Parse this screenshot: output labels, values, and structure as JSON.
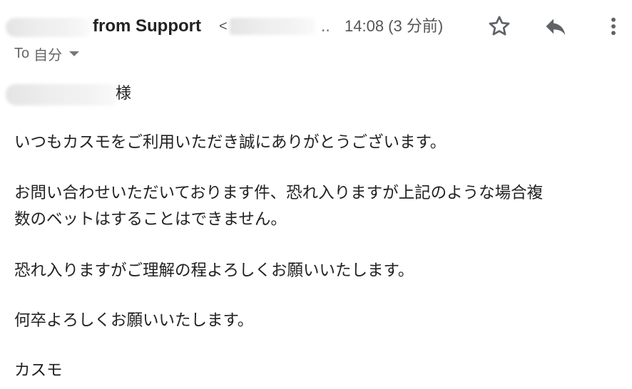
{
  "header": {
    "sender_name": "from Support",
    "sender_bracket": "<",
    "email_ellipsis": "..",
    "time": "14:08 (3 分前)",
    "icons": {
      "star": "star-icon",
      "reply": "reply-icon",
      "more": "more-vert-icon"
    }
  },
  "recipient": {
    "label": "To",
    "value": "自分"
  },
  "body": {
    "salutation_suffix": "様",
    "paragraphs": [
      "いつもカスモをご利用いただき誠にありがとうございます。",
      "お問い合わせいただいております件、恐れ入りますが上記のような場合複",
      "数のベットはすることはできません。",
      "恐れ入りますがご理解の程よろしくお願いいたします。",
      "何卒よろしくお願いいたします。",
      "カスモ"
    ]
  },
  "colors": {
    "text": "#222222",
    "muted": "#555555",
    "icon": "#5f6368"
  }
}
